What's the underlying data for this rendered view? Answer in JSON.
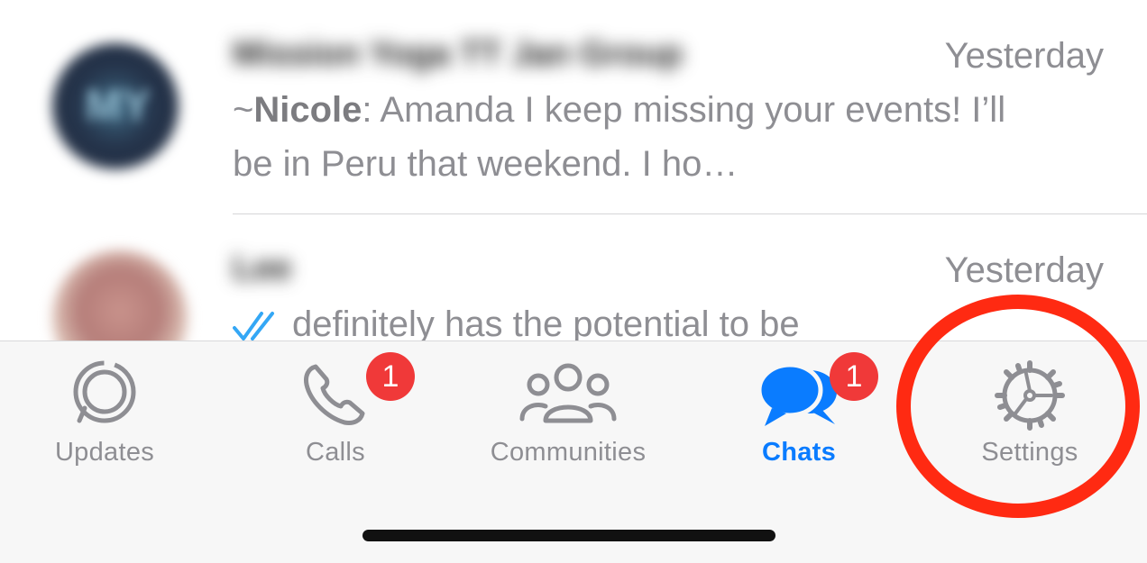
{
  "chats": [
    {
      "name": "Mission Yoga TT Jan Group",
      "time": "Yesterday",
      "sender": "Nicole",
      "sender_prefix": "~",
      "message": ": Amanda I keep missing your events! I’ll be in Peru that weekend. I ho…"
    },
    {
      "name": "Lee",
      "time": "Yesterday",
      "message": "definitely has the potential to be"
    }
  ],
  "tabs": {
    "updates": "Updates",
    "calls": "Calls",
    "calls_badge": "1",
    "communities": "Communities",
    "chats": "Chats",
    "chats_badge": "1",
    "settings": "Settings"
  },
  "colors": {
    "accent": "#0a7cff",
    "badge": "#f03939",
    "highlight": "#ff2a12",
    "muted": "#8e8e93"
  }
}
